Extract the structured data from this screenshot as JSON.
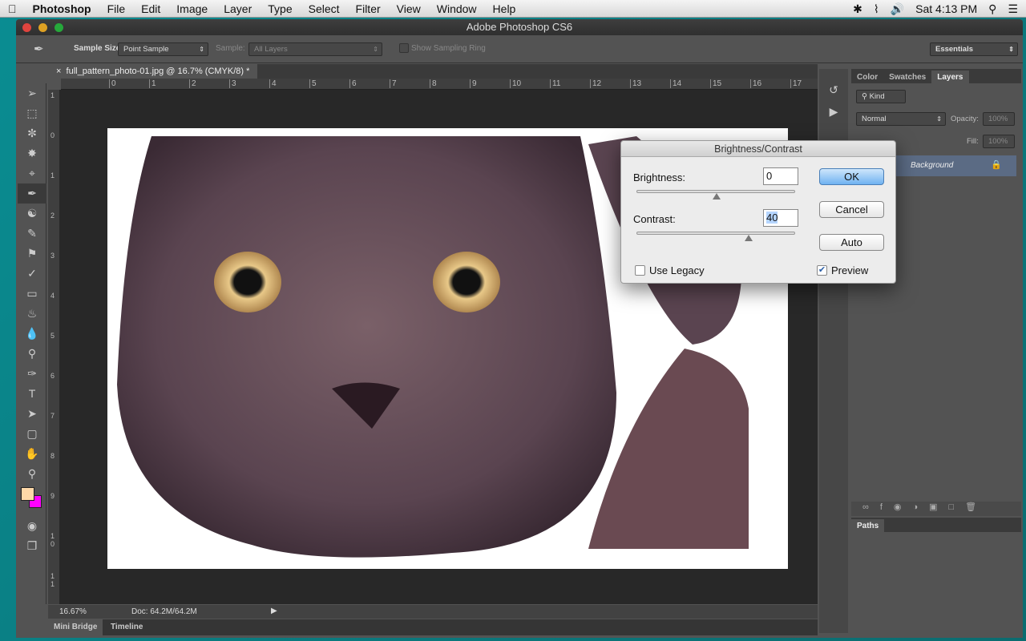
{
  "menubar": {
    "app": "Photoshop",
    "items": [
      "File",
      "Edit",
      "Image",
      "Layer",
      "Type",
      "Select",
      "Filter",
      "View",
      "Window",
      "Help"
    ],
    "clock": "Sat 4:13 PM"
  },
  "window": {
    "title": "Adobe Photoshop CS6"
  },
  "options": {
    "sample_size_label": "Sample Size:",
    "sample_size_value": "Point Sample",
    "sample_label": "Sample:",
    "sample_value": "All Layers",
    "show_ring": "Show Sampling Ring",
    "workspace": "Essentials"
  },
  "document": {
    "tab": "full_pattern_photo-01.jpg @ 16.7% (CMYK/8) *",
    "ruler_h": [
      "0",
      "1",
      "2",
      "3",
      "4",
      "5",
      "6",
      "7",
      "8",
      "9",
      "10",
      "11",
      "12",
      "13",
      "14",
      "15",
      "16",
      "17"
    ],
    "ruler_v": [
      "1",
      "0",
      "1",
      "2",
      "3",
      "4",
      "5",
      "6",
      "7",
      "8",
      "9",
      "1 0",
      "1 1"
    ]
  },
  "status": {
    "zoom": "16.67%",
    "doc": "Doc: 64.2M/64.2M"
  },
  "bottom_tabs": [
    "Mini Bridge",
    "Timeline"
  ],
  "panels": {
    "tabs": [
      "Color",
      "Swatches",
      "Layers"
    ],
    "active": "Layers",
    "kind": "Kind",
    "blend": "Normal",
    "opacity_label": "Opacity:",
    "opacity": "100%",
    "fill_label": "Fill:",
    "fill": "100%",
    "layer_name": "Background",
    "paths_tab": "Paths"
  },
  "dialog": {
    "title": "Brightness/Contrast",
    "brightness_label": "Brightness:",
    "brightness": "0",
    "contrast_label": "Contrast:",
    "contrast": "40",
    "ok": "OK",
    "cancel": "Cancel",
    "auto": "Auto",
    "use_legacy": "Use Legacy",
    "use_legacy_checked": false,
    "preview": "Preview",
    "preview_checked": true,
    "brightness_range": [
      -150,
      150
    ],
    "contrast_range": [
      -50,
      100
    ]
  },
  "colors": {
    "foreground": "#fdd8a8",
    "background": "#ff00ff",
    "accent": "#4a7fb8"
  }
}
